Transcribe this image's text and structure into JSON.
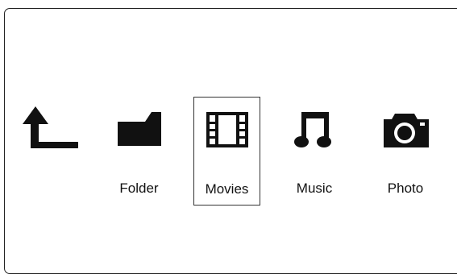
{
  "menu": {
    "back": {
      "icon": "return-arrow-icon"
    },
    "items": [
      {
        "label": "Folder",
        "icon": "folder-icon",
        "selected": false
      },
      {
        "label": "Movies",
        "icon": "film-icon",
        "selected": true
      },
      {
        "label": "Music",
        "icon": "music-note-icon",
        "selected": false
      },
      {
        "label": "Photo",
        "icon": "camera-icon",
        "selected": false
      }
    ]
  },
  "colors": {
    "icon": "#111111",
    "border": "#222222",
    "background": "#ffffff"
  }
}
